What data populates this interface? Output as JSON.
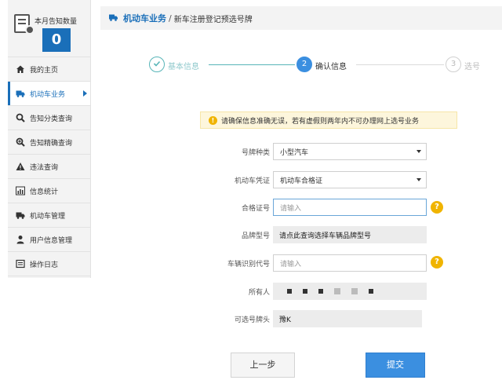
{
  "sidebar": {
    "summary_title": "本月告知数量",
    "summary_count": "0",
    "items": [
      {
        "label": "我的主页",
        "icon": "home-icon"
      },
      {
        "label": "机动车业务",
        "icon": "truck-icon",
        "active": true
      },
      {
        "label": "告知分类查询",
        "icon": "search-icon"
      },
      {
        "label": "告知精确查询",
        "icon": "zoom-icon"
      },
      {
        "label": "违法查询",
        "icon": "warning-icon"
      },
      {
        "label": "信息统计",
        "icon": "bar-chart-icon"
      },
      {
        "label": "机动车管理",
        "icon": "truck-icon"
      },
      {
        "label": "用户信息管理",
        "icon": "user-icon"
      },
      {
        "label": "操作日志",
        "icon": "log-icon"
      }
    ]
  },
  "header": {
    "section": "机动车业务",
    "separator": "/",
    "page": "新车注册登记预选号牌"
  },
  "steps": [
    {
      "num": "1",
      "label": "基本信息",
      "state": "done"
    },
    {
      "num": "2",
      "label": "确认信息",
      "state": "active"
    },
    {
      "num": "3",
      "label": "选号",
      "state": "pending"
    }
  ],
  "notice": {
    "icon": "!",
    "text": "请确保信息准确无误，若有虚假则两年内不可办理网上选号业务"
  },
  "form": {
    "plate_type": {
      "label": "号牌种类",
      "value": "小型汽车"
    },
    "certificate": {
      "label": "机动车凭证",
      "value": "机动车合格证"
    },
    "cert_number": {
      "label": "合格证号",
      "placeholder": "请输入"
    },
    "brand_model": {
      "label": "品牌型号",
      "value": "请点此查询选择车辆品牌型号"
    },
    "vin": {
      "label": "车辆识别代号",
      "placeholder": "请输入"
    },
    "owner": {
      "label": "所有人"
    },
    "prefix": {
      "label": "可选号牌头",
      "value": "豫K"
    },
    "help_icon": "?"
  },
  "buttons": {
    "prev": "上一步",
    "submit": "提交"
  },
  "colors": {
    "accent": "#1a6fb9",
    "submit": "#3b8fe0",
    "warning": "#f0b400",
    "step_done": "#58b5b8"
  }
}
